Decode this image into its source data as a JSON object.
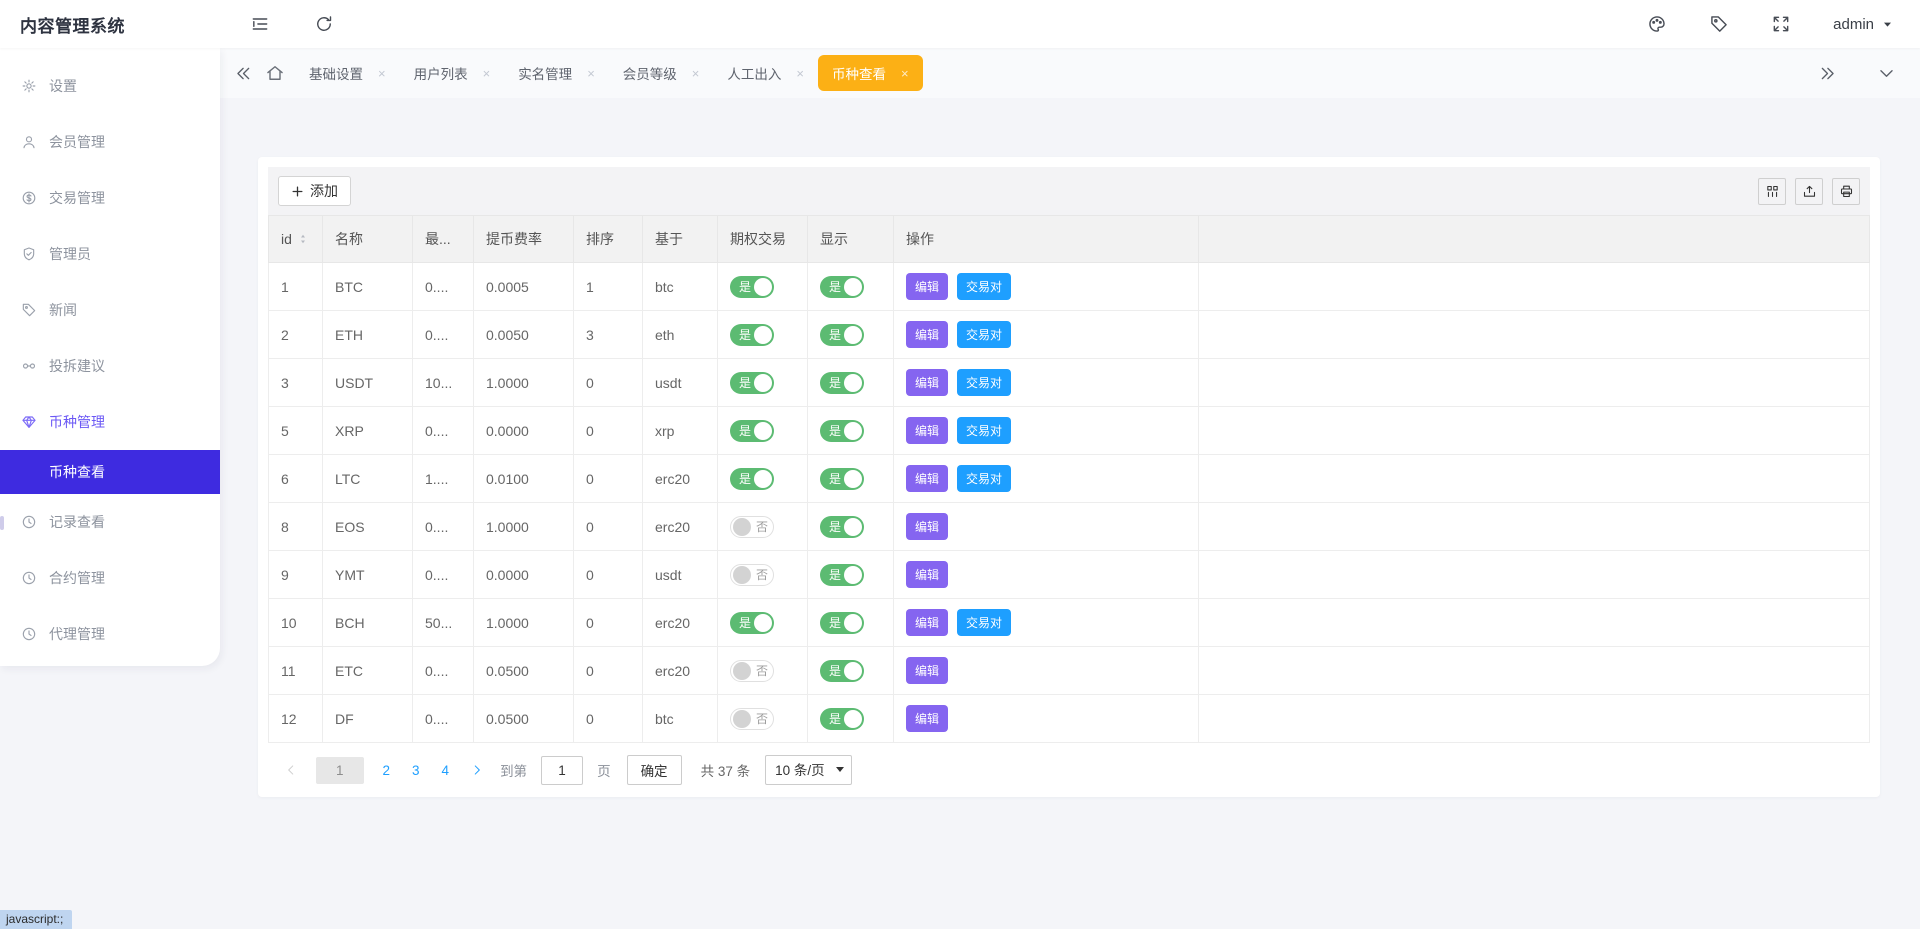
{
  "colors": {
    "active_tab_yellow": "#fcb015",
    "sidebar_active_indigo": "#3e2be0",
    "menu_highlight_purple": "#6b58f5",
    "edit_button_purple": "#8565f0",
    "pair_button_blue": "#1e9fff",
    "toggle_green": "#5cbb72"
  },
  "app": {
    "title": "内容管理系统",
    "status_text": "javascript:;"
  },
  "topbar": {
    "user_label": "admin"
  },
  "tabbar": {
    "tabs": [
      {
        "label": "基础设置",
        "active": false
      },
      {
        "label": "用户列表",
        "active": false
      },
      {
        "label": "实名管理",
        "active": false
      },
      {
        "label": "会员等级",
        "active": false
      },
      {
        "label": "人工出入",
        "active": false
      },
      {
        "label": "币种查看",
        "active": true
      }
    ]
  },
  "sidebar": {
    "items": [
      {
        "label": "设置",
        "icon": "gear-icon",
        "type": "parent"
      },
      {
        "label": "会员管理",
        "icon": "user-icon",
        "type": "parent"
      },
      {
        "label": "交易管理",
        "icon": "dollar-circle-icon",
        "type": "parent"
      },
      {
        "label": "管理员",
        "icon": "shield-check-icon",
        "type": "parent"
      },
      {
        "label": "新闻",
        "icon": "tag-icon",
        "type": "parent"
      },
      {
        "label": "投拆建议",
        "icon": "link-icon",
        "type": "parent"
      },
      {
        "label": "币种管理",
        "icon": "gem-icon",
        "type": "parent",
        "highlight": true
      },
      {
        "label": "币种查看",
        "type": "sub",
        "active": true
      },
      {
        "label": "记录查看",
        "icon": "history-icon",
        "type": "parent"
      },
      {
        "label": "合约管理",
        "icon": "contract-icon",
        "type": "parent"
      },
      {
        "label": "代理管理",
        "icon": "agent-icon",
        "type": "parent"
      }
    ]
  },
  "toolbar": {
    "add_label": "添加"
  },
  "table": {
    "headers": [
      "id",
      "名称",
      "最...",
      "提币费率",
      "排序",
      "基于",
      "期权交易",
      "显示",
      "操作"
    ],
    "toggle_on": "是",
    "toggle_off": "否",
    "edit_label": "编辑",
    "pair_label": "交易对",
    "rows": [
      {
        "id": "1",
        "name": "BTC",
        "max": "0....",
        "fee": "0.0005",
        "sort": "1",
        "base": "btc",
        "option": true,
        "show": true,
        "pair": true
      },
      {
        "id": "2",
        "name": "ETH",
        "max": "0....",
        "fee": "0.0050",
        "sort": "3",
        "base": "eth",
        "option": true,
        "show": true,
        "pair": true
      },
      {
        "id": "3",
        "name": "USDT",
        "max": "10...",
        "fee": "1.0000",
        "sort": "0",
        "base": "usdt",
        "option": true,
        "show": true,
        "pair": true
      },
      {
        "id": "5",
        "name": "XRP",
        "max": "0....",
        "fee": "0.0000",
        "sort": "0",
        "base": "xrp",
        "option": true,
        "show": true,
        "pair": true
      },
      {
        "id": "6",
        "name": "LTC",
        "max": "1....",
        "fee": "0.0100",
        "sort": "0",
        "base": "erc20",
        "option": true,
        "show": true,
        "pair": true
      },
      {
        "id": "8",
        "name": "EOS",
        "max": "0....",
        "fee": "1.0000",
        "sort": "0",
        "base": "erc20",
        "option": false,
        "show": true,
        "pair": false
      },
      {
        "id": "9",
        "name": "YMT",
        "max": "0....",
        "fee": "0.0000",
        "sort": "0",
        "base": "usdt",
        "option": false,
        "show": true,
        "pair": false
      },
      {
        "id": "10",
        "name": "BCH",
        "max": "50...",
        "fee": "1.0000",
        "sort": "0",
        "base": "erc20",
        "option": true,
        "show": true,
        "pair": true
      },
      {
        "id": "11",
        "name": "ETC",
        "max": "0....",
        "fee": "0.0500",
        "sort": "0",
        "base": "erc20",
        "option": false,
        "show": true,
        "pair": false
      },
      {
        "id": "12",
        "name": "DF",
        "max": "0....",
        "fee": "0.0500",
        "sort": "0",
        "base": "btc",
        "option": false,
        "show": true,
        "pair": false
      }
    ]
  },
  "pagination": {
    "pages": [
      "1",
      "2",
      "3",
      "4"
    ],
    "current": "1",
    "goto_label": "到第",
    "goto_value": "1",
    "page_suffix": "页",
    "confirm_label": "确定",
    "total_label": "共 37 条",
    "page_size": "10 条/页"
  }
}
